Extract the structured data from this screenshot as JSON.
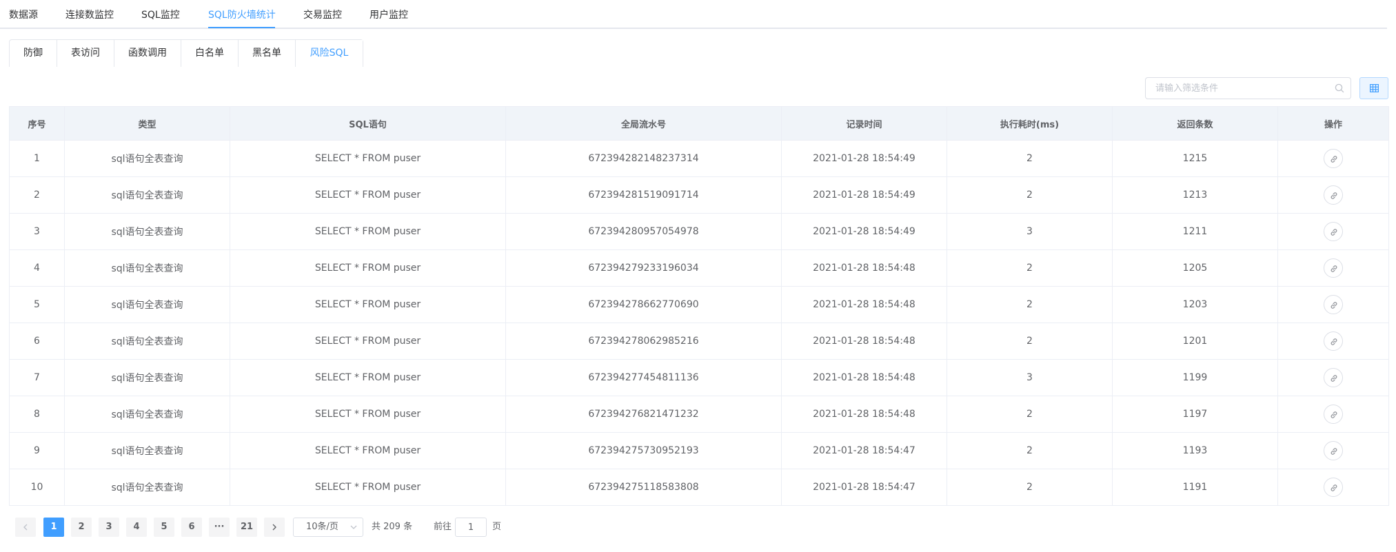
{
  "top_tabs": [
    "数据源",
    "连接数监控",
    "SQL监控",
    "SQL防火墙统计",
    "交易监控",
    "用户监控"
  ],
  "top_tabs_active": "SQL防火墙统计",
  "sub_tabs": [
    "防御",
    "表访问",
    "函数调用",
    "白名单",
    "黑名单",
    "风险SQL"
  ],
  "sub_tabs_active": "风险SQL",
  "search": {
    "placeholder": "请输入筛选条件",
    "icon": "search-icon"
  },
  "view_toggle": {
    "icon": "grid-icon"
  },
  "table": {
    "columns": [
      "序号",
      "类型",
      "SQL语句",
      "全局流水号",
      "记录时间",
      "执行耗时(ms)",
      "返回条数",
      "操作"
    ],
    "rows": [
      [
        "1",
        "sql语句全表查询",
        "SELECT * FROM puser",
        "672394282148237314",
        "2021-01-28 18:54:49",
        "2",
        "1215"
      ],
      [
        "2",
        "sql语句全表查询",
        "SELECT * FROM puser",
        "672394281519091714",
        "2021-01-28 18:54:49",
        "2",
        "1213"
      ],
      [
        "3",
        "sql语句全表查询",
        "SELECT * FROM puser",
        "672394280957054978",
        "2021-01-28 18:54:49",
        "3",
        "1211"
      ],
      [
        "4",
        "sql语句全表查询",
        "SELECT * FROM puser",
        "672394279233196034",
        "2021-01-28 18:54:48",
        "2",
        "1205"
      ],
      [
        "5",
        "sql语句全表查询",
        "SELECT * FROM puser",
        "672394278662770690",
        "2021-01-28 18:54:48",
        "2",
        "1203"
      ],
      [
        "6",
        "sql语句全表查询",
        "SELECT * FROM puser",
        "672394278062985216",
        "2021-01-28 18:54:48",
        "2",
        "1201"
      ],
      [
        "7",
        "sql语句全表查询",
        "SELECT * FROM puser",
        "672394277454811136",
        "2021-01-28 18:54:48",
        "3",
        "1199"
      ],
      [
        "8",
        "sql语句全表查询",
        "SELECT * FROM puser",
        "672394276821471232",
        "2021-01-28 18:54:48",
        "2",
        "1197"
      ],
      [
        "9",
        "sql语句全表查询",
        "SELECT * FROM puser",
        "672394275730952193",
        "2021-01-28 18:54:47",
        "2",
        "1193"
      ],
      [
        "10",
        "sql语句全表查询",
        "SELECT * FROM puser",
        "672394275118583808",
        "2021-01-28 18:54:47",
        "2",
        "1191"
      ]
    ],
    "action_icon": "link-icon"
  },
  "pagination": {
    "pages": [
      "1",
      "2",
      "3",
      "4",
      "5",
      "6",
      "···",
      "21"
    ],
    "current": "1",
    "page_size": "10条/页",
    "total_text": "共 209 条",
    "goto_label": "前往",
    "goto_value": "1",
    "goto_suffix": "页"
  },
  "colors": {
    "accent": "#409eff",
    "header_bg": "#f0f4f9",
    "border": "#ebeef5"
  }
}
